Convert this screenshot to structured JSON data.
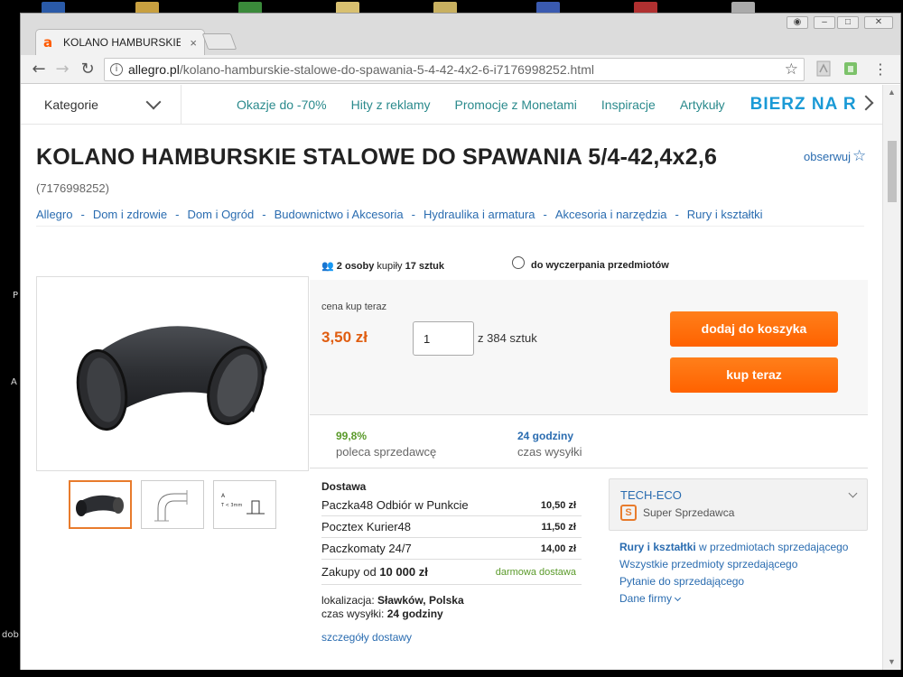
{
  "desktop": {
    "letters": [
      "P",
      "A",
      "dob"
    ]
  },
  "browser": {
    "tab_title": "KOLANO HAMBURSKIE S",
    "tab_close": "×",
    "url_domain": "allegro.pl",
    "url_path": "/kolano-hamburskie-stalowe-do-spawania-5-4-42-4x2-6-i7176998252.html",
    "icons": [
      "back-arrow-icon",
      "forward-arrow-icon",
      "reload-icon",
      "info-icon",
      "star-icon",
      "pdf-extension-icon",
      "evernote-extension-icon",
      "menu-dots-icon"
    ]
  },
  "nav": {
    "kategorie": "Kategorie",
    "links": [
      "Okazje do -70%",
      "Hity z reklamy",
      "Promocje z Monetami",
      "Inspiracje",
      "Artykuły"
    ],
    "banner": "BIERZ NA R"
  },
  "product": {
    "title": "KOLANO HAMBURSKIE STALOWE DO SPAWANIA 5/4-42,4x2,6",
    "offer_id": "(7176998252)",
    "watch": "obserwuj",
    "breadcrumb": [
      "Allegro",
      "Dom i zdrowie",
      "Dom i Ogród",
      "Budownictwo i Akcesoria",
      "Hydraulika i armatura",
      "Akcesoria i narzędzia",
      "Rury i kształtki"
    ],
    "breadcrumb_sep": "-"
  },
  "stats": {
    "bought_count": "2 osoby",
    "bought_mid": " kupiły ",
    "bought_qty": "17 sztuk",
    "until": "do wyczerpania przedmiotów"
  },
  "buy": {
    "price_label": "cena kup teraz",
    "price": "3,50 zł",
    "quantity": "1",
    "available": "z 384 sztuk",
    "add_to_cart": "dodaj do koszyka",
    "buy_now": "kup teraz"
  },
  "seller_stats": {
    "recommend_value": "99,8%",
    "recommend_label": "poleca sprzedawcę",
    "ship_value": "24 godziny",
    "ship_label": "czas wysyłki"
  },
  "delivery": {
    "title": "Dostawa",
    "options": [
      {
        "name": "Paczka48 Odbiór w Punkcie",
        "price": "10,50 zł"
      },
      {
        "name": "Pocztex Kurier48",
        "price": "11,50 zł"
      },
      {
        "name": "Paczkomaty 24/7",
        "price": "14,00 zł"
      }
    ],
    "free_from_label": "Zakupy od ",
    "free_from_value": "10 000 zł",
    "free_label": "darmowa dostawa",
    "location_label": "lokalizacja: ",
    "location_value": "Sławków, Polska",
    "ship_time_label": "czas wysyłki: ",
    "ship_time_value": "24 godziny",
    "details_link": "szczegóły dostawy"
  },
  "seller": {
    "name": "TECH-ECO",
    "badge": "S",
    "badge_label": "Super Sprzedawca",
    "category_link_bold": "Rury i kształtki",
    "category_link_rest": " w przedmiotach sprzedającego",
    "all_items": "Wszystkie przedmioty sprzedającego",
    "ask": "Pytanie do sprzedającego",
    "company_data": "Dane firmy"
  },
  "colors": {
    "accent_orange": "#ff6a00",
    "link_blue": "#2a6cb0",
    "teal": "#2a8a8c",
    "green": "#5a9a2a"
  }
}
